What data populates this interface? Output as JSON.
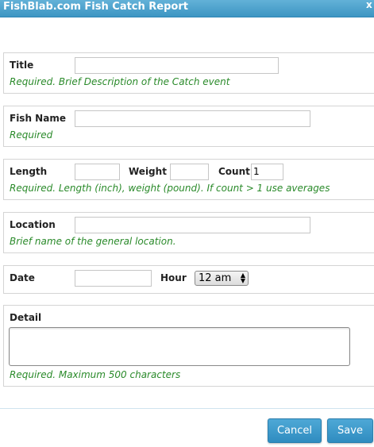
{
  "window": {
    "title": "FishBlab.com Fish Catch Report",
    "close_glyph": "x"
  },
  "form": {
    "title": {
      "label": "Title",
      "value": "",
      "hint": "Required. Brief Description of the Catch event"
    },
    "fish_name": {
      "label": "Fish Name",
      "value": "",
      "hint": "Required"
    },
    "measurements": {
      "length_label": "Length",
      "length_value": "",
      "weight_label": "Weight",
      "weight_value": "",
      "count_label": "Count",
      "count_value": "1",
      "hint": "Required. Length (inch), weight (pound). If count > 1 use averages"
    },
    "location": {
      "label": "Location",
      "value": "",
      "hint": "Brief name of the general location."
    },
    "datetime": {
      "date_label": "Date",
      "date_value": "",
      "hour_label": "Hour",
      "hour_selected": "12 am"
    },
    "detail": {
      "label": "Detail",
      "value": "",
      "hint": "Required. Maximum 500 characters"
    }
  },
  "buttons": {
    "cancel": "Cancel",
    "save": "Save"
  },
  "colors": {
    "titlebar": "#4aa3cf",
    "hint_text": "#2a8a2a",
    "button": "#3a95c7"
  }
}
